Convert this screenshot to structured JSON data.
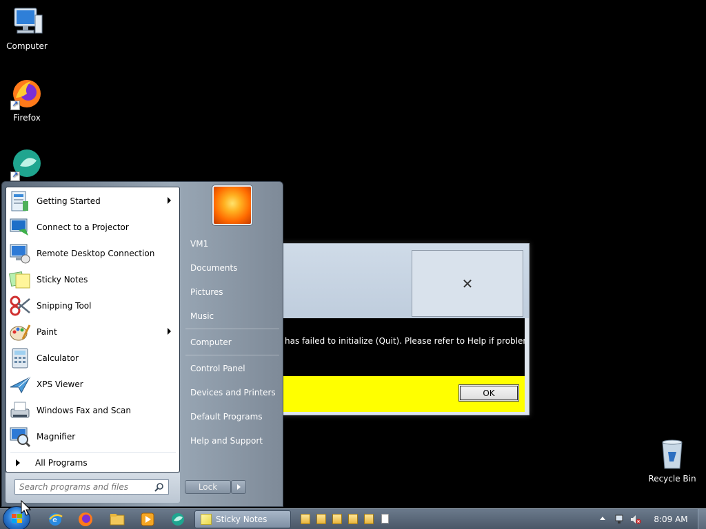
{
  "desktop": {
    "icons": [
      {
        "label": "Computer"
      },
      {
        "label": "Firefox"
      },
      {
        "label": ""
      },
      {
        "label": "Recycle Bin"
      }
    ]
  },
  "dialog": {
    "message": "has failed to initialize (Quit). Please refer to Help if problem",
    "close_glyph": "✕",
    "ok_label": "OK",
    "footer_color": "#ffff00"
  },
  "start_menu": {
    "programs": [
      {
        "label": "Getting Started",
        "submenu": true
      },
      {
        "label": "Connect to a Projector",
        "submenu": false
      },
      {
        "label": "Remote Desktop Connection",
        "submenu": false
      },
      {
        "label": "Sticky Notes",
        "submenu": false
      },
      {
        "label": "Snipping Tool",
        "submenu": false
      },
      {
        "label": "Paint",
        "submenu": true
      },
      {
        "label": "Calculator",
        "submenu": false
      },
      {
        "label": "XPS Viewer",
        "submenu": false
      },
      {
        "label": "Windows Fax and Scan",
        "submenu": false
      },
      {
        "label": "Magnifier",
        "submenu": false
      }
    ],
    "all_programs_label": "All Programs",
    "search_placeholder": "Search programs and files",
    "right_items": [
      "VM1",
      "Documents",
      "Pictures",
      "Music",
      "Computer",
      "Control Panel",
      "Devices and Printers",
      "Default Programs",
      "Help and Support"
    ],
    "lock_label": "Lock"
  },
  "taskbar": {
    "active_task_label": "Sticky Notes",
    "clock": "8:09 AM"
  }
}
